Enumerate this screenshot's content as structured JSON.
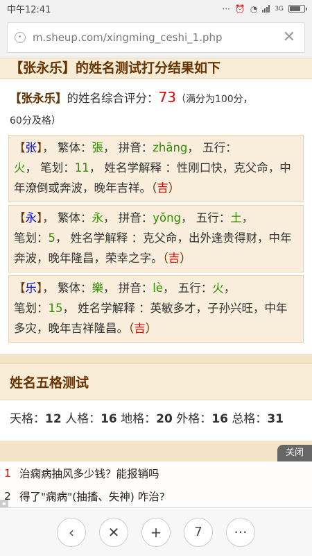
{
  "status": {
    "time": "中午12:41",
    "network": "3G"
  },
  "browser": {
    "url": "m.sheup.com/xingming_ceshi_1.php"
  },
  "result": {
    "title_name": "【张永乐】",
    "title_suffix": "的姓名测试打分结果如下",
    "summary_name": "【张永乐】",
    "summary_label": "的姓名综合评分：",
    "score": "73",
    "note_line1": "（满分为100分，",
    "note_line2": "60分及格）",
    "chars": [
      {
        "char": "张",
        "traditional": "張",
        "pinyin": "zhāng",
        "element": "火",
        "strokes": "11",
        "meaning": "性刚口快，克父命，中年潦倒或奔波，晚年吉祥。",
        "luck": "吉"
      },
      {
        "char": "永",
        "traditional": "永",
        "pinyin": "yǒng",
        "element": "土",
        "strokes": "5",
        "meaning": "克父命，出外逢贵得财，中年奔波，晚年隆昌，荣幸之字。",
        "luck": "吉"
      },
      {
        "char": "乐",
        "traditional": "樂",
        "pinyin": "lè",
        "element": "火",
        "strokes": "15",
        "meaning": "英敏多才，子孙兴旺，中年多灾，晚年吉祥隆昌。",
        "luck": "吉"
      }
    ],
    "labels": {
      "traditional": "繁体：",
      "pinyin": "拼音：",
      "element": "五行：",
      "strokes": "笔划：",
      "meaning": "姓名学解释 ：",
      "sep": "，",
      "open": "【",
      "close": "】",
      "lparen": "（",
      "rparen": "）"
    }
  },
  "wuge": {
    "title": "姓名五格测试",
    "items": [
      {
        "label": "天格：",
        "value": "12"
      },
      {
        "label": "人格：",
        "value": "16"
      },
      {
        "label": "地格：",
        "value": "20"
      },
      {
        "label": "外格：",
        "value": "16"
      },
      {
        "label": "总格：",
        "value": "31"
      }
    ]
  },
  "ad": {
    "close_label": "关闭",
    "items": [
      {
        "num": "1",
        "text": "治痫病抽风多少钱？能报销吗"
      },
      {
        "num": "2",
        "text": "得了\"痫病\"(抽搐、失神) 咋治?"
      }
    ]
  },
  "toolbar": {
    "tab_count": "7"
  },
  "colors": {
    "accent_red": "#e60000",
    "brown": "#663300",
    "green": "#2f8f00",
    "blue": "#0000cc",
    "page_bg": "#f3e4c8"
  }
}
